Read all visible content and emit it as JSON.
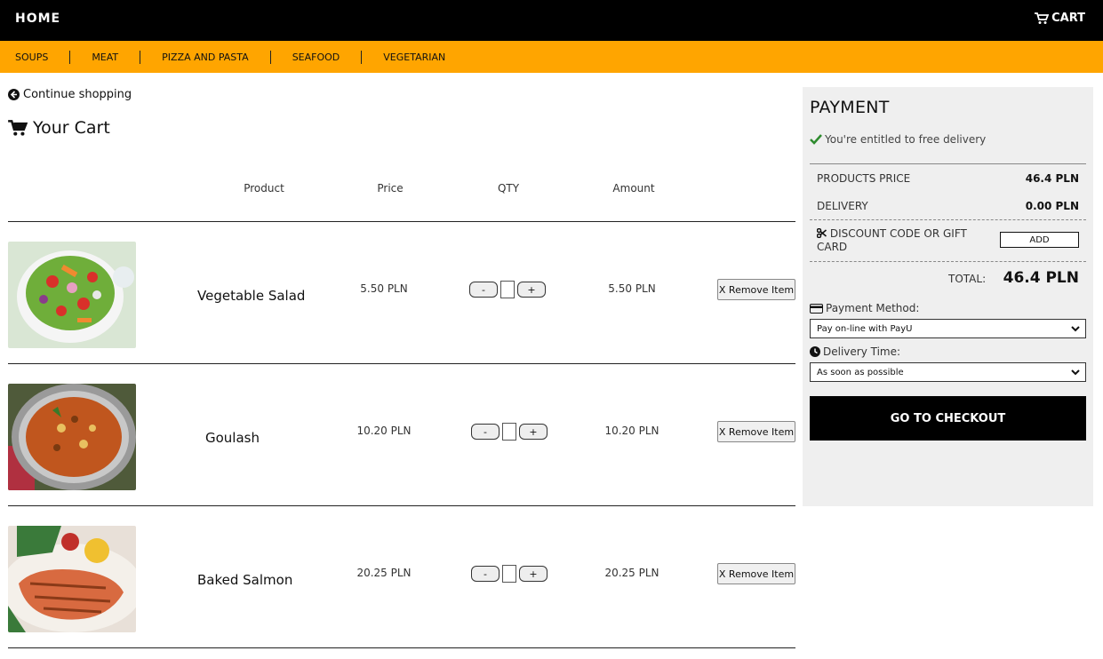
{
  "topbar": {
    "home": "HOME",
    "cart": "CART"
  },
  "categories": [
    "SOUPS",
    "MEAT",
    "PIZZA AND PASTA",
    "SEAFOOD",
    "VEGETARIAN"
  ],
  "continue_label": "Continue shopping",
  "cart_title": "Your Cart",
  "table_headers": {
    "product": "Product",
    "price": "Price",
    "qty": "QTY",
    "amount": "Amount"
  },
  "items": [
    {
      "name": "Vegetable Salad",
      "price": "5.50 PLN",
      "amount": "5.50 PLN",
      "remove": "X Remove Item",
      "minus": "-",
      "plus": "+"
    },
    {
      "name": "Goulash",
      "price": "10.20 PLN",
      "amount": "10.20 PLN",
      "remove": "X Remove Item",
      "minus": "-",
      "plus": "+"
    },
    {
      "name": "Baked Salmon",
      "price": "20.25 PLN",
      "amount": "20.25 PLN",
      "remove": "X Remove Item",
      "minus": "-",
      "plus": "+"
    }
  ],
  "payment": {
    "title": "PAYMENT",
    "free_delivery": "You're entitled to free delivery",
    "products_price_label": "PRODUCTS PRICE",
    "products_price_value": "46.4 PLN",
    "delivery_label": "DELIVERY",
    "delivery_value": "0.00 PLN",
    "discount_label": "DISCOUNT CODE OR GIFT CARD",
    "add_label": "ADD",
    "total_label": "TOTAL:",
    "total_value": "46.4 PLN",
    "method_label": "Payment Method:",
    "method_value": "Pay on-line with PayU",
    "time_label": "Delivery Time:",
    "time_value": "As soon as possible",
    "checkout_label": "GO TO CHECKOUT"
  },
  "colors": {
    "topbar": "#000000",
    "category_bar": "#ffa500",
    "panel": "#efefef",
    "check": "#2e8b2e"
  }
}
